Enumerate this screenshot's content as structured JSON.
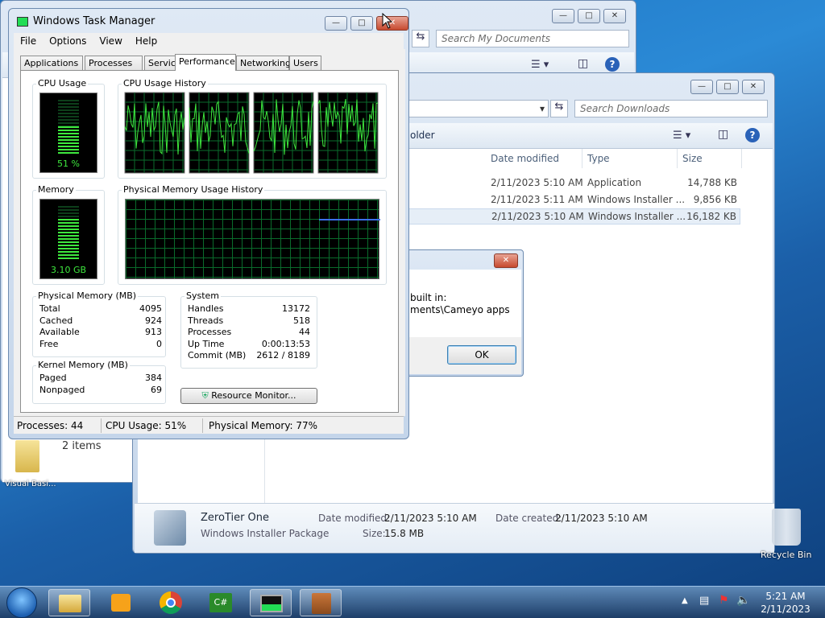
{
  "my_docs_window": {
    "search_placeholder": "Search My Documents",
    "items_count": "2 items",
    "desktop_item": "Visual Basi..."
  },
  "downloads_window": {
    "search_placeholder": "Search Downloads",
    "cmd_partial": "older",
    "columns": [
      "Date modified",
      "Type",
      "Size"
    ],
    "rows": [
      {
        "date": "2/11/2023 5:10 AM",
        "type": "Application",
        "size": "14,788 KB"
      },
      {
        "date": "2/11/2023 5:11 AM",
        "type": "Windows Installer ...",
        "size": "9,856 KB"
      },
      {
        "date": "2/11/2023 5:10 AM",
        "type": "Windows Installer ...",
        "size": "16,182 KB"
      }
    ],
    "details": {
      "name": "ZeroTier One",
      "kind": "Windows Installer Package",
      "date_modified_label": "Date modified:",
      "date_modified": "2/11/2023 5:10 AM",
      "date_created_label": "Date created:",
      "date_created": "2/11/2023 5:10 AM",
      "size_label": "Size:",
      "size": "15.8 MB"
    }
  },
  "dialog": {
    "line1": "built in:",
    "line2": "ments\\Cameyo apps",
    "ok_label": "OK"
  },
  "task_manager": {
    "title": "Windows Task Manager",
    "menu": [
      "File",
      "Options",
      "View",
      "Help"
    ],
    "tabs": [
      "Applications",
      "Processes",
      "Services",
      "Performance",
      "Networking",
      "Users"
    ],
    "active_tab": "Performance",
    "cpu_usage_label": "CPU Usage",
    "cpu_value": "51 %",
    "cpu_fraction": 0.51,
    "cpu_history_label": "CPU Usage History",
    "memory_label": "Memory",
    "memory_value": "3.10 GB",
    "memory_fraction": 0.77,
    "mem_history_label": "Physical Memory Usage History",
    "physical_memory": {
      "label": "Physical Memory (MB)",
      "rows": [
        [
          "Total",
          "4095"
        ],
        [
          "Cached",
          "924"
        ],
        [
          "Available",
          "913"
        ],
        [
          "Free",
          "0"
        ]
      ]
    },
    "kernel_memory": {
      "label": "Kernel Memory (MB)",
      "rows": [
        [
          "Paged",
          "384"
        ],
        [
          "Nonpaged",
          "69"
        ]
      ]
    },
    "system": {
      "label": "System",
      "rows": [
        [
          "Handles",
          "13172"
        ],
        [
          "Threads",
          "518"
        ],
        [
          "Processes",
          "44"
        ],
        [
          "Up Time",
          "0:00:13:53"
        ],
        [
          "Commit (MB)",
          "2612 / 8189"
        ]
      ]
    },
    "resource_monitor_label": "Resource Monitor...",
    "status": {
      "processes": "Processes: 44",
      "cpu": "CPU Usage: 51%",
      "memory": "Physical Memory: 77%"
    }
  },
  "desktop": {
    "recycle_bin": "Recycle Bin"
  },
  "taskbar": {
    "time": "5:21 AM",
    "date": "2/11/2023"
  }
}
